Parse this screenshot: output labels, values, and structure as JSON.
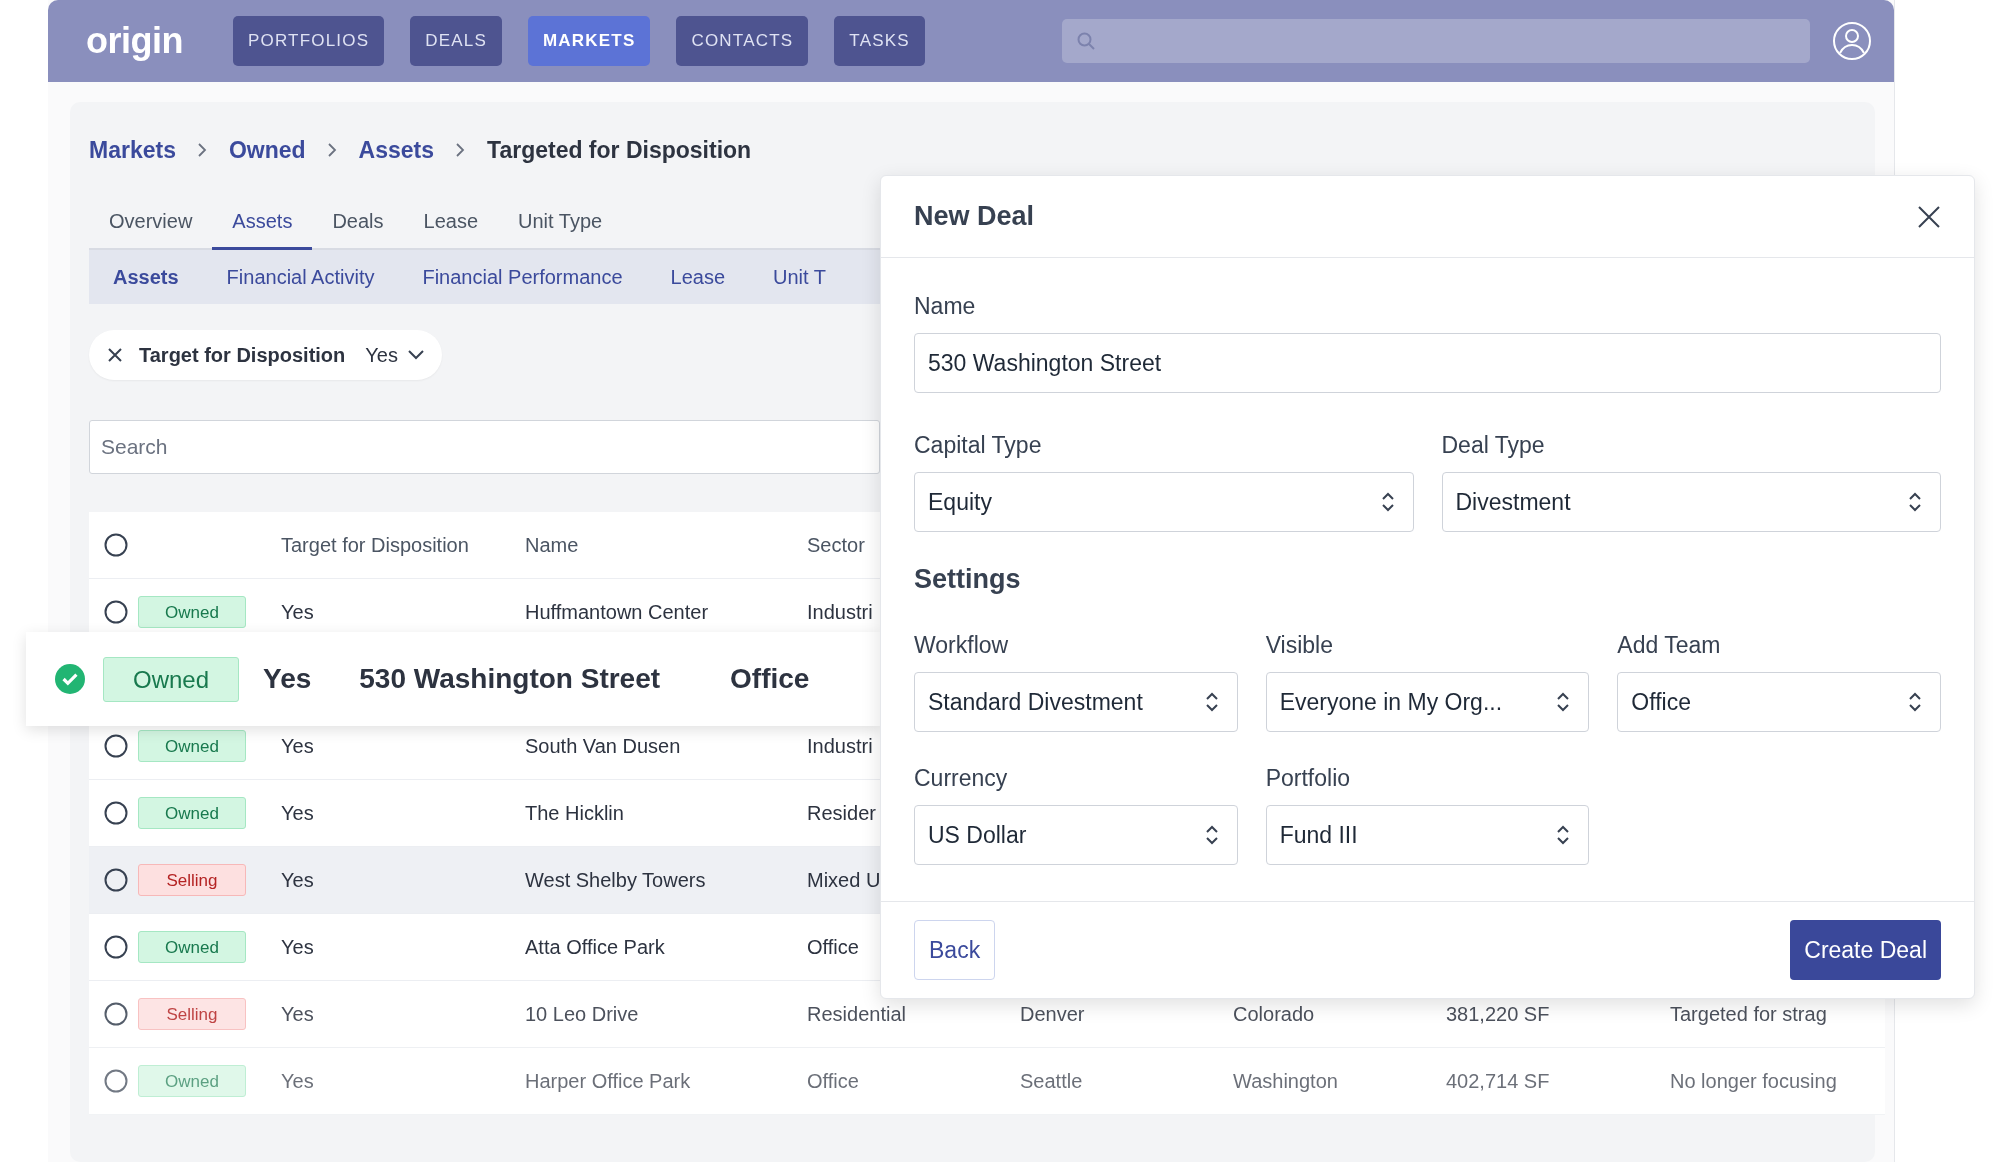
{
  "topbar": {
    "logo": "origin",
    "nav": [
      {
        "label": "PORTFOLIOS",
        "selected": false
      },
      {
        "label": "DEALS",
        "selected": false
      },
      {
        "label": "MARKETS",
        "selected": true
      },
      {
        "label": "CONTACTS",
        "selected": false
      },
      {
        "label": "TASKS",
        "selected": false
      }
    ]
  },
  "breadcrumbs": [
    "Markets",
    "Owned",
    "Assets",
    "Targeted for Disposition"
  ],
  "tabs": [
    {
      "label": "Overview",
      "selected": false
    },
    {
      "label": "Assets",
      "selected": true
    },
    {
      "label": "Deals",
      "selected": false
    },
    {
      "label": "Lease",
      "selected": false
    },
    {
      "label": "Unit Type",
      "selected": false
    }
  ],
  "subtabs": [
    {
      "label": "Assets",
      "selected": true
    },
    {
      "label": "Financial Activity",
      "selected": false
    },
    {
      "label": "Financial Performance",
      "selected": false
    },
    {
      "label": "Lease",
      "selected": false
    },
    {
      "label": "Unit T",
      "selected": false
    }
  ],
  "filter": {
    "label": "Target for Disposition",
    "value": "Yes"
  },
  "search": {
    "placeholder": "Search"
  },
  "table": {
    "select_all": {
      "checked": false
    },
    "columns": [
      "Target for Disposition",
      "Name",
      "Sector"
    ],
    "rows": [
      {
        "selected": false,
        "highlighted": false,
        "status": {
          "label": "Owned",
          "kind": "owned"
        },
        "cells": [
          "Yes",
          "Huffmantown Center",
          "Industri"
        ]
      },
      {
        "selected": false,
        "highlighted": false,
        "status": {
          "label": "Owned",
          "kind": "owned"
        },
        "cells": [
          "Yes",
          "South Van Dusen",
          "Industri"
        ]
      },
      {
        "selected": false,
        "highlighted": false,
        "status": {
          "label": "Owned",
          "kind": "owned"
        },
        "cells": [
          "Yes",
          "The Hicklin",
          "Resider"
        ]
      },
      {
        "selected": false,
        "highlighted": true,
        "status": {
          "label": "Selling",
          "kind": "selling"
        },
        "cells": [
          "Yes",
          "West Shelby Towers",
          "Mixed U"
        ]
      },
      {
        "selected": false,
        "highlighted": false,
        "status": {
          "label": "Owned",
          "kind": "owned"
        },
        "cells": [
          "Yes",
          "Atta Office Park",
          "Office"
        ]
      },
      {
        "selected": false,
        "highlighted": false,
        "status": {
          "label": "Selling",
          "kind": "selling"
        },
        "cells": [
          "Yes",
          "10 Leo Drive",
          "Residential",
          "Denver",
          "Colorado",
          "381,220 SF",
          "Targeted for strag"
        ]
      },
      {
        "selected": false,
        "highlighted": false,
        "status": {
          "label": "Owned",
          "kind": "owned"
        },
        "cells": [
          "Yes",
          "Harper Office Park",
          "Office",
          "Seattle",
          "Washington",
          "402,714 SF",
          "No longer focusing"
        ]
      }
    ]
  },
  "dragged_row": {
    "selected": true,
    "status": {
      "label": "Owned",
      "kind": "owned"
    },
    "cells": [
      "Yes",
      "530 Washington Street",
      "Office"
    ]
  },
  "modal": {
    "title": "New Deal",
    "name": {
      "label": "Name",
      "value": "530 Washington Street"
    },
    "fields": [
      {
        "label": "Capital Type",
        "value": "Equity"
      },
      {
        "label": "Deal Type",
        "value": "Divestment"
      }
    ],
    "section": "Settings",
    "settings": [
      {
        "label": "Workflow",
        "value": "Standard Divestment"
      },
      {
        "label": "Visible",
        "value": "Everyone in My Org..."
      },
      {
        "label": "Add Team",
        "value": "Office"
      },
      {
        "label": "Currency",
        "value": "US Dollar"
      },
      {
        "label": "Portfolio",
        "value": "Fund III"
      }
    ],
    "back": "Back",
    "create": "Create Deal"
  }
}
